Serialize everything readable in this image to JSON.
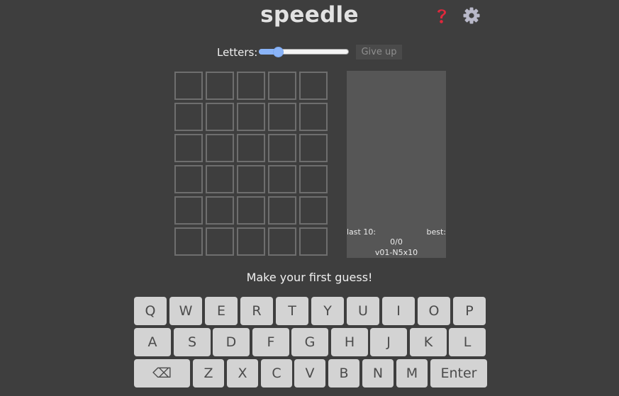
{
  "header": {
    "title": "speedle",
    "help_icon": "question-mark-icon",
    "settings_icon": "gear-icon"
  },
  "controls": {
    "letters_label": "Letters:",
    "letters_slider_fraction": 0.18,
    "give_up_label": "Give up"
  },
  "board": {
    "rows": 6,
    "cols": 5,
    "cells": [
      [
        "",
        "",
        "",
        "",
        ""
      ],
      [
        "",
        "",
        "",
        "",
        ""
      ],
      [
        "",
        "",
        "",
        "",
        ""
      ],
      [
        "",
        "",
        "",
        "",
        ""
      ],
      [
        "",
        "",
        "",
        "",
        ""
      ],
      [
        "",
        "",
        "",
        "",
        ""
      ]
    ]
  },
  "stats": {
    "last_label": "last 10:",
    "best_label": "best:",
    "score": "0/0",
    "version": "v01-N5x10"
  },
  "message": "Make your first guess!",
  "keyboard": {
    "rows": [
      [
        "Q",
        "W",
        "E",
        "R",
        "T",
        "Y",
        "U",
        "I",
        "O",
        "P"
      ],
      [
        "A",
        "S",
        "D",
        "F",
        "G",
        "H",
        "J",
        "K",
        "L"
      ],
      [
        "⌫",
        "Z",
        "X",
        "C",
        "V",
        "B",
        "N",
        "M",
        "Enter"
      ]
    ]
  },
  "colors": {
    "background": "#3e3e3e",
    "key": "#d3d3d3",
    "key_text": "#4b4b4b",
    "accent": "#8ab4f8",
    "panel": "#565656"
  }
}
